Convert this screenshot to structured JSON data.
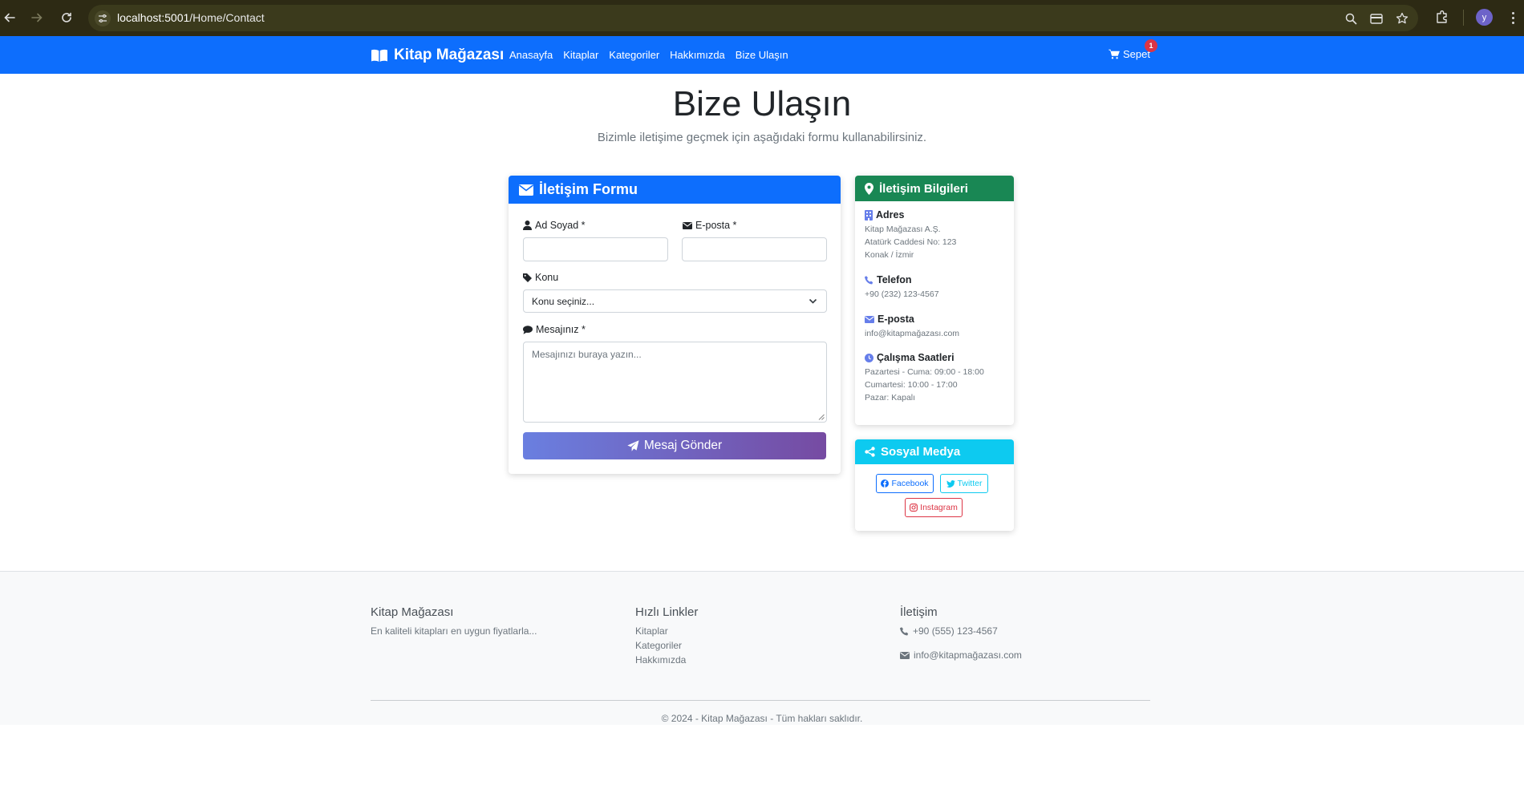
{
  "browser": {
    "url_host": "localhost:5001",
    "url_path": "/Home/Contact",
    "profile_initial": "y"
  },
  "navbar": {
    "brand": "Kitap Mağazası",
    "links": [
      "Anasayfa",
      "Kitaplar",
      "Kategoriler",
      "Hakkımızda",
      "Bize Ulaşın"
    ],
    "cart_label": "Sepet",
    "cart_count": "1"
  },
  "page": {
    "title": "Bize Ulaşın",
    "lead": "Bizimle iletişime geçmek için aşağıdaki formu kullanabilirsiniz."
  },
  "form": {
    "header": "İletişim Formu",
    "name_label": "Ad Soyad *",
    "name_value": "",
    "email_label": "E-posta *",
    "email_value": "",
    "subject_label": "Konu",
    "subject_selected": "Konu seçiniz...",
    "message_label": "Mesajınız *",
    "message_placeholder": "Mesajınızı buraya yazın...",
    "submit_label": "Mesaj Gönder"
  },
  "contact_info": {
    "header": "İletişim Bilgileri",
    "address_title": "Adres",
    "address_lines": [
      "Kitap Mağazası A.Ş.",
      "Atatürk Caddesi No: 123",
      "Konak / İzmir"
    ],
    "phone_title": "Telefon",
    "phone": "+90 (232) 123-4567",
    "email_title": "E-posta",
    "email": "info@kitapmağazası.com",
    "hours_title": "Çalışma Saatleri",
    "hours_lines": [
      "Pazartesi - Cuma: 09:00 - 18:00",
      "Cumartesi: 10:00 - 17:00",
      "Pazar: Kapalı"
    ]
  },
  "social": {
    "header": "Sosyal Medya",
    "facebook": "Facebook",
    "twitter": "Twitter",
    "instagram": "Instagram"
  },
  "footer": {
    "about_title": "Kitap Mağazası",
    "about_text": "En kaliteli kitapları en uygun fiyatlarla...",
    "links_title": "Hızlı Linkler",
    "links": [
      "Kitaplar",
      "Kategoriler",
      "Hakkımızda"
    ],
    "contact_title": "İletişim",
    "phone": "+90 (555) 123-4567",
    "email": "info@kitapmağazası.com",
    "copyright": "© 2024 - Kitap Mağazası - Tüm hakları saklıdır."
  },
  "colors": {
    "primary": "#0d6efd",
    "success": "#198754",
    "info": "#0dcaf0",
    "danger": "#dc3545",
    "button_gradient_start": "#6a7fe0",
    "button_gradient_end": "#764ba2"
  }
}
